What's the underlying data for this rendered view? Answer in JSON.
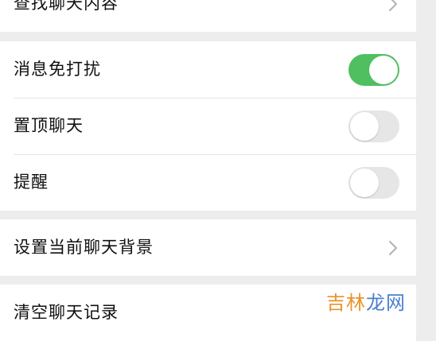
{
  "find": {
    "label": "查找聊天内容"
  },
  "toggles": [
    {
      "label": "消息免打扰",
      "state": "on"
    },
    {
      "label": "置顶聊天",
      "state": "off"
    },
    {
      "label": "提醒",
      "state": "off"
    }
  ],
  "background": {
    "label": "设置当前聊天背景"
  },
  "clear": {
    "label": "清空聊天记录"
  },
  "watermark": {
    "part1": "吉林",
    "part2": "龙网"
  },
  "colors": {
    "toggle_on": "#4fbf5f",
    "toggle_off": "#e6e6e6",
    "page_background": "#ededed",
    "chevron": "#b2b2b2",
    "watermark_orange": "#e8932b",
    "watermark_blue": "#4a7fd0"
  },
  "icons": {
    "chevron": "chevron-right-icon"
  }
}
